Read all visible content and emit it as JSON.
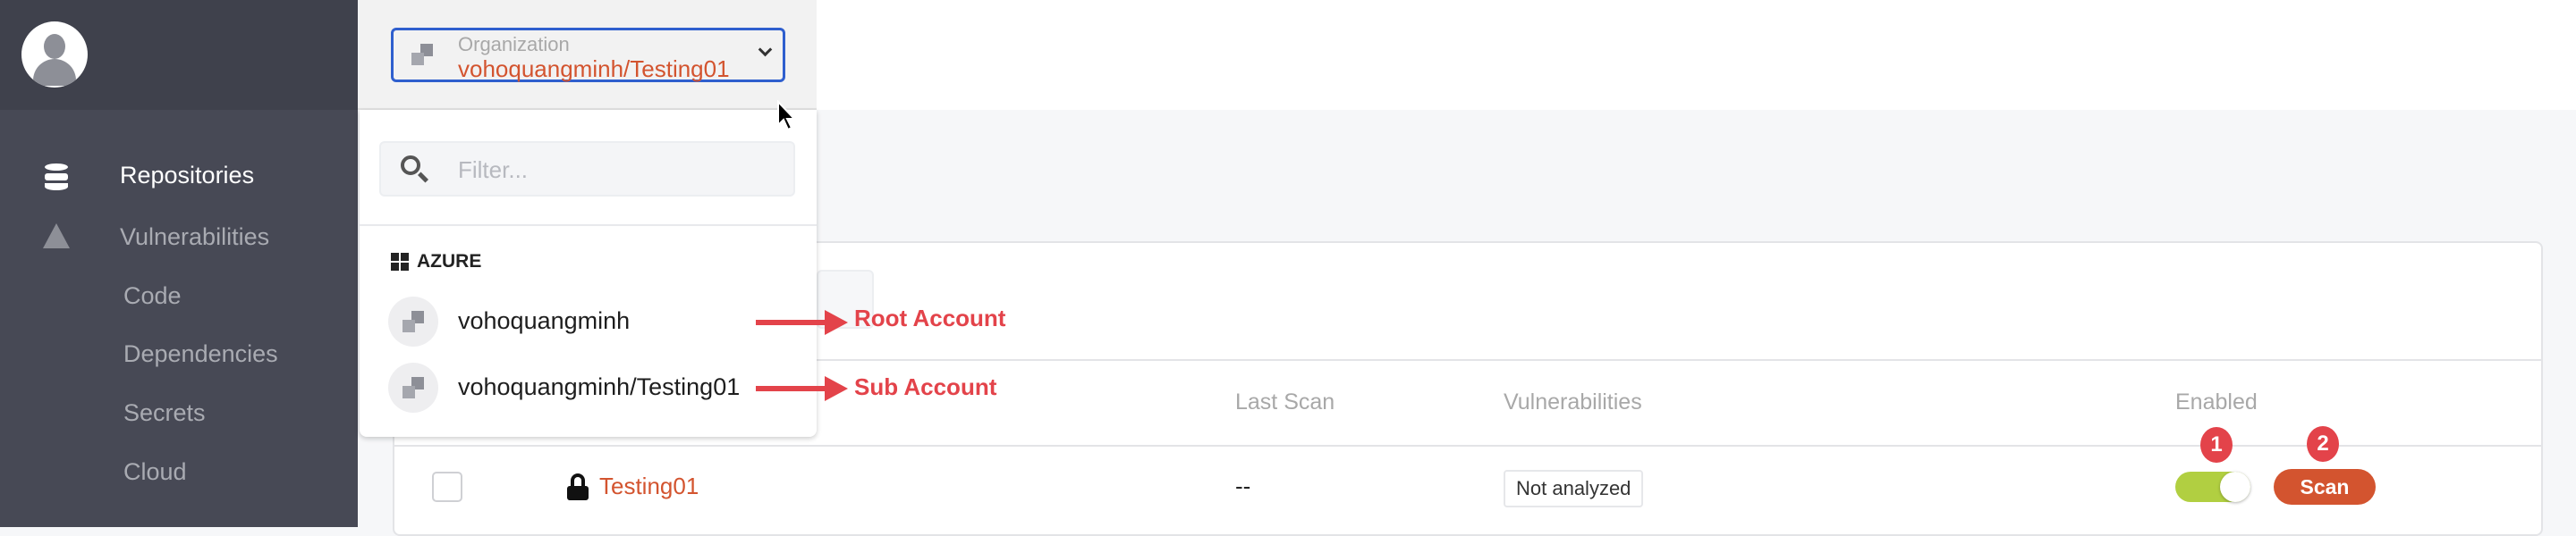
{
  "sidebar": {
    "items": [
      {
        "label": "Repositories",
        "icon": "database-icon",
        "active": true
      },
      {
        "label": "Vulnerabilities",
        "icon": "warning-icon"
      },
      {
        "label": "Code"
      },
      {
        "label": "Dependencies"
      },
      {
        "label": "Secrets"
      },
      {
        "label": "Cloud"
      }
    ]
  },
  "org_selector": {
    "label": "Organization",
    "value": "vohoquangminh/Testing01"
  },
  "dropdown": {
    "filter_placeholder": "Filter...",
    "group": "AZURE",
    "items": [
      "vohoquangminh",
      "vohoquangminh/Testing01"
    ]
  },
  "annotations": {
    "root": "Root Account",
    "sub": "Sub Account",
    "badge1": "1",
    "badge2": "2",
    "color": "#e3434a"
  },
  "table": {
    "columns": [
      "Last Scan",
      "Vulnerabilities",
      "Enabled"
    ],
    "rows": [
      {
        "name": "Testing01",
        "last_scan": "--",
        "vulnerabilities": "Not analyzed",
        "enabled": true,
        "action": "Scan"
      }
    ]
  },
  "colors": {
    "accent": "#d3542f",
    "toggle_on": "#b1cf41",
    "focus": "#2f5fce"
  }
}
